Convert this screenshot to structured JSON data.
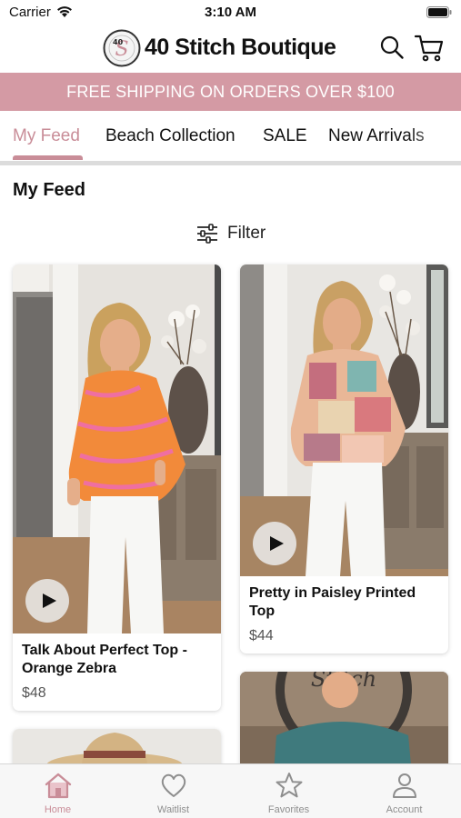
{
  "status_bar": {
    "carrier": "Carrier",
    "time": "3:10 AM"
  },
  "header": {
    "brand": "40 Stitch Boutique",
    "logo_text": "40 Stitch"
  },
  "promo": {
    "text": "FREE SHIPPING ON ORDERS OVER $100"
  },
  "tabs": [
    {
      "label": "My Feed",
      "active": true
    },
    {
      "label": "Beach Collection",
      "active": false
    },
    {
      "label": "SALE",
      "active": false
    },
    {
      "label": "New Arrivals",
      "active": false
    }
  ],
  "feed": {
    "title": "My Feed",
    "filter_label": "Filter",
    "products": [
      {
        "title": "Talk About Perfect Top - Orange Zebra",
        "price": "$48",
        "has_video": true
      },
      {
        "title": "Pretty in Paisley Printed Top",
        "price": "$44",
        "has_video": true
      }
    ]
  },
  "tab_bar": {
    "items": [
      {
        "label": "Home",
        "icon": "home-icon",
        "active": true
      },
      {
        "label": "Waitlist",
        "icon": "heart-icon",
        "active": false
      },
      {
        "label": "Favorites",
        "icon": "star-icon",
        "active": false
      },
      {
        "label": "Account",
        "icon": "person-icon",
        "active": false
      }
    ]
  },
  "colors": {
    "accent": "#c98d98",
    "promo_bg": "#d49aa4",
    "inactive": "#8e8e8e"
  }
}
